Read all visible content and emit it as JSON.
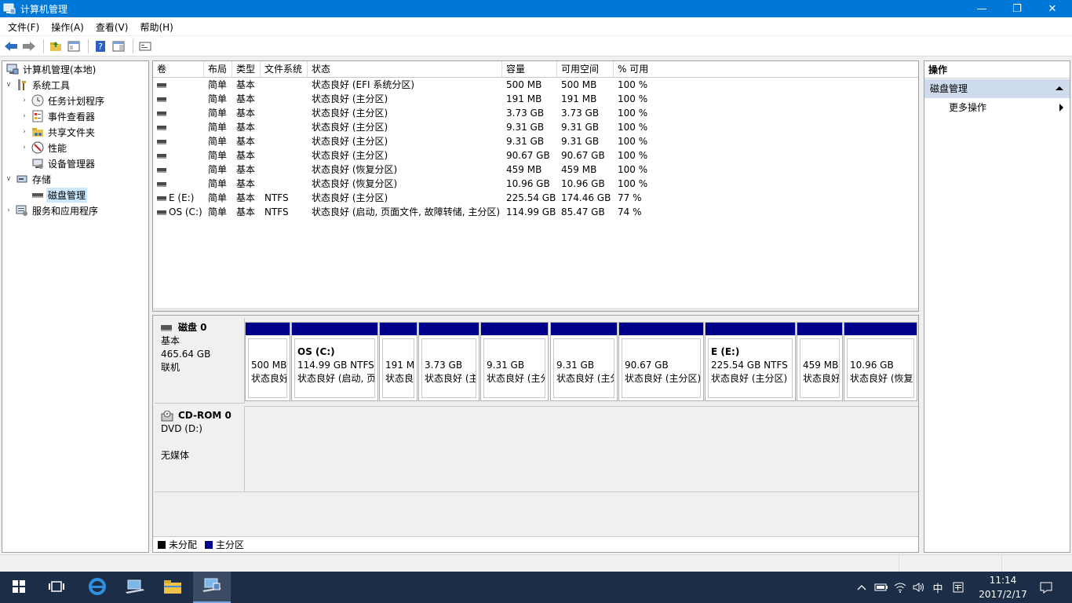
{
  "window": {
    "title": "计算机管理",
    "minimize": "—",
    "maximize": "❐",
    "close": "✕"
  },
  "menu": [
    "文件(F)",
    "操作(A)",
    "查看(V)",
    "帮助(H)"
  ],
  "tree": {
    "root": "计算机管理(本地)",
    "system_tools": "系统工具",
    "task_scheduler": "任务计划程序",
    "event_viewer": "事件查看器",
    "shared_folders": "共享文件夹",
    "performance": "性能",
    "device_manager": "设备管理器",
    "storage": "存储",
    "disk_management": "磁盘管理",
    "services_apps": "服务和应用程序"
  },
  "volumes": {
    "columns": [
      "卷",
      "布局",
      "类型",
      "文件系统",
      "状态",
      "容量",
      "可用空间",
      "% 可用"
    ],
    "rows": [
      {
        "vol": "",
        "layout": "简单",
        "type": "基本",
        "fs": "",
        "status": "状态良好 (EFI 系统分区)",
        "cap": "500 MB",
        "free": "500 MB",
        "pct": "100 %"
      },
      {
        "vol": "",
        "layout": "简单",
        "type": "基本",
        "fs": "",
        "status": "状态良好 (主分区)",
        "cap": "191 MB",
        "free": "191 MB",
        "pct": "100 %"
      },
      {
        "vol": "",
        "layout": "简单",
        "type": "基本",
        "fs": "",
        "status": "状态良好 (主分区)",
        "cap": "3.73 GB",
        "free": "3.73 GB",
        "pct": "100 %"
      },
      {
        "vol": "",
        "layout": "简单",
        "type": "基本",
        "fs": "",
        "status": "状态良好 (主分区)",
        "cap": "9.31 GB",
        "free": "9.31 GB",
        "pct": "100 %"
      },
      {
        "vol": "",
        "layout": "简单",
        "type": "基本",
        "fs": "",
        "status": "状态良好 (主分区)",
        "cap": "9.31 GB",
        "free": "9.31 GB",
        "pct": "100 %"
      },
      {
        "vol": "",
        "layout": "简单",
        "type": "基本",
        "fs": "",
        "status": "状态良好 (主分区)",
        "cap": "90.67 GB",
        "free": "90.67 GB",
        "pct": "100 %"
      },
      {
        "vol": "",
        "layout": "简单",
        "type": "基本",
        "fs": "",
        "status": "状态良好 (恢复分区)",
        "cap": "459 MB",
        "free": "459 MB",
        "pct": "100 %"
      },
      {
        "vol": "",
        "layout": "简单",
        "type": "基本",
        "fs": "",
        "status": "状态良好 (恢复分区)",
        "cap": "10.96 GB",
        "free": "10.96 GB",
        "pct": "100 %"
      },
      {
        "vol": "E (E:)",
        "layout": "简单",
        "type": "基本",
        "fs": "NTFS",
        "status": "状态良好 (主分区)",
        "cap": "225.54 GB",
        "free": "174.46 GB",
        "pct": "77 %"
      },
      {
        "vol": "OS (C:)",
        "layout": "简单",
        "type": "基本",
        "fs": "NTFS",
        "status": "状态良好 (启动, 页面文件, 故障转储, 主分区)",
        "cap": "114.99 GB",
        "free": "85.47 GB",
        "pct": "74 %"
      }
    ]
  },
  "disk0": {
    "name": "磁盘 0",
    "kind": "基本",
    "size": "465.64 GB",
    "state": "联机",
    "partitions": [
      {
        "name": "",
        "size": "500 MB",
        "status": "状态良好"
      },
      {
        "name": "OS  (C:)",
        "size": "114.99 GB NTFS",
        "status": "状态良好 (启动, 页"
      },
      {
        "name": "",
        "size": "191 M",
        "status": "状态良"
      },
      {
        "name": "",
        "size": "3.73 GB",
        "status": "状态良好 (主"
      },
      {
        "name": "",
        "size": "9.31 GB",
        "status": "状态良好 (主分"
      },
      {
        "name": "",
        "size": "9.31 GB",
        "status": "状态良好 (主分"
      },
      {
        "name": "",
        "size": "90.67 GB",
        "status": "状态良好 (主分区)"
      },
      {
        "name": "E  (E:)",
        "size": "225.54 GB NTFS",
        "status": "状态良好 (主分区)"
      },
      {
        "name": "",
        "size": "459 MB",
        "status": "状态良好"
      },
      {
        "name": "",
        "size": "10.96 GB",
        "status": "状态良好 (恢复"
      }
    ]
  },
  "cdrom": {
    "name": "CD-ROM 0",
    "drive": "DVD (D:)",
    "media": "无媒体"
  },
  "legend": {
    "unallocated": "未分配",
    "primary": "主分区",
    "unallocated_color": "#000000",
    "primary_color": "#00008b"
  },
  "actions": {
    "title": "操作",
    "section": "磁盘管理",
    "more": "更多操作"
  },
  "taskbar": {
    "ime": "中",
    "time": "11:14",
    "date": "2017/2/17"
  }
}
